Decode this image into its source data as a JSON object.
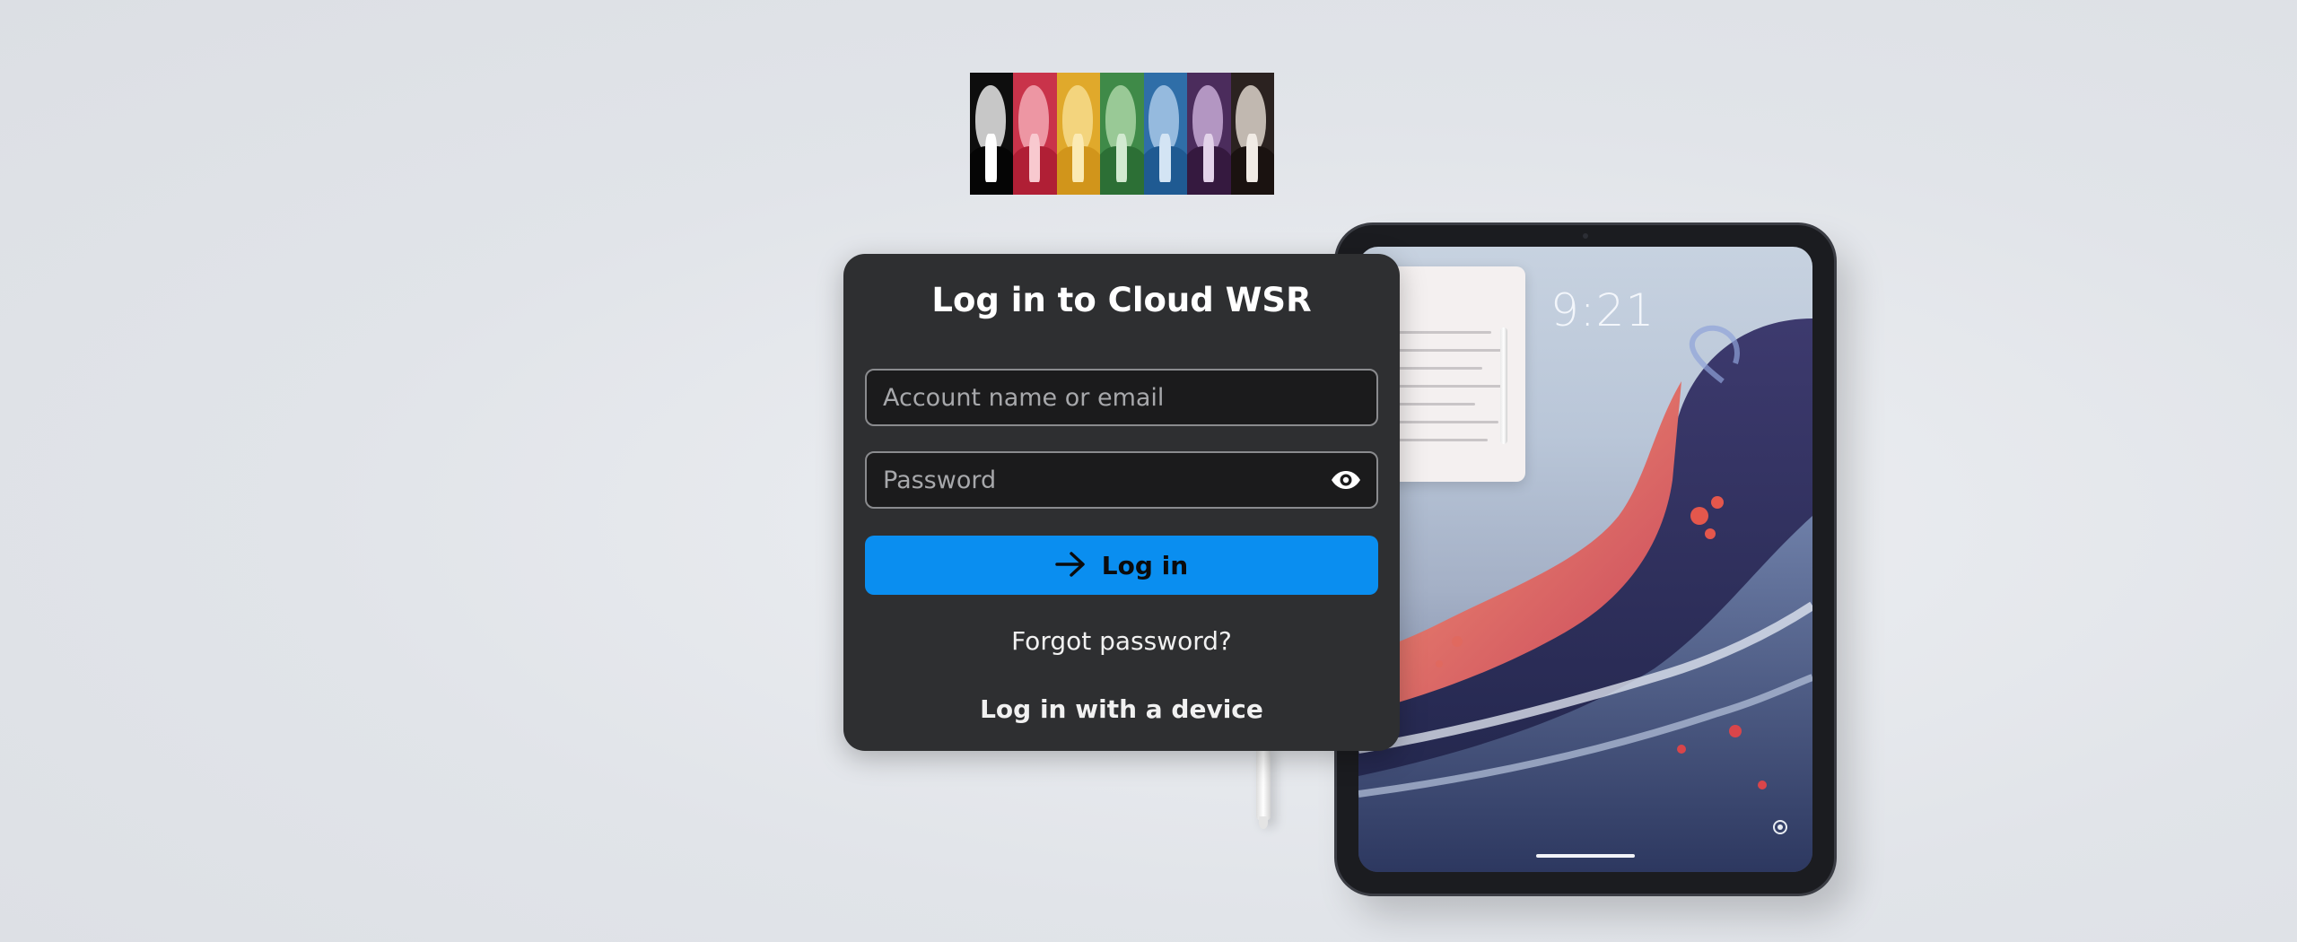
{
  "login": {
    "title": "Log in to Cloud WSR",
    "account_placeholder": "Account name or email",
    "password_placeholder": "Password",
    "login_button_label": "Log in",
    "forgot_password": "Forgot password?",
    "device_login": "Log in with a device"
  },
  "tablet": {
    "clock": "9:21"
  },
  "icons": {
    "show_password": "eye-icon",
    "login_arrow": "arrow-right-icon"
  },
  "colors": {
    "page_background": "#e1e4e9",
    "card_background": "#2e2f31",
    "field_background": "#1b1b1c",
    "accent": "#0a8ef0"
  }
}
